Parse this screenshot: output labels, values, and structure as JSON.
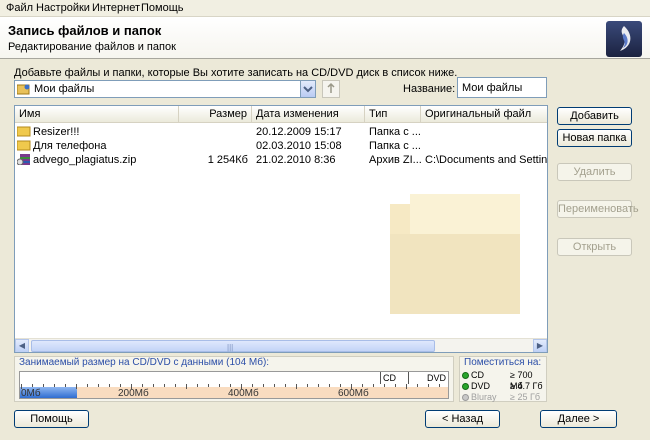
{
  "menu": [
    "Файл",
    "Настройки",
    "Интернет",
    "Помощь"
  ],
  "header": {
    "title": "Запись файлов и папок",
    "subtitle": "Редактирование файлов и папок"
  },
  "instruction": "Добавьте файлы и папки, которые Вы хотите записать на CD/DVD диск в список ниже.",
  "folder_combo": {
    "value": "Мои файлы",
    "icon": "folder-user-icon"
  },
  "name_field": {
    "label": "Название:",
    "value": "Мои файлы"
  },
  "list": {
    "columns": [
      "Имя",
      "Размер",
      "Дата изменения",
      "Тип",
      "Оригинальный файл"
    ],
    "rows": [
      {
        "name": "Resizer!!!",
        "size": "",
        "date": "20.12.2009 15:17",
        "type": "Папка с ...",
        "orig": "",
        "icon": "folder-icon"
      },
      {
        "name": "Для телефона",
        "size": "",
        "date": "02.03.2010 15:08",
        "type": "Папка с ...",
        "orig": "",
        "icon": "folder-icon"
      },
      {
        "name": "advego_plagiatus.zip",
        "size": "1 254Кб",
        "date": "21.02.2010 8:36",
        "type": "Архив ZI...",
        "orig": "C:\\Documents and Settings\\Ад",
        "icon": "winrar-archive-icon"
      }
    ]
  },
  "buttons": {
    "add": "Добавить",
    "new_folder": "Новая папка",
    "delete": "Удалить",
    "rename": "Переименовать",
    "open": "Открыть"
  },
  "capacity": {
    "label": "Занимаемый размер на CD/DVD с данными (104 Мб):",
    "used_mb": 104,
    "ticks": [
      "0Мб",
      "200Мб",
      "400Мб",
      "600Мб"
    ],
    "markers": [
      "CD",
      "DVD"
    ]
  },
  "fits": {
    "label": "Поместиться на:",
    "items": [
      {
        "name": "CD",
        "value": "≥ 700 Мб",
        "ok": true
      },
      {
        "name": "DVD",
        "value": "≥ 4.7 Гб",
        "ok": true
      },
      {
        "name": "Bluray",
        "value": "≥ 25 Гб",
        "ok": false
      }
    ]
  },
  "footer": {
    "help": "Помощь",
    "back": "< Назад",
    "next": "Далее >"
  },
  "colors": {
    "accent": "#2c4fa8",
    "used_fill": "#2f6dd1",
    "free_fill": "#f9dcc0",
    "ok_dot": "#29a52c"
  }
}
